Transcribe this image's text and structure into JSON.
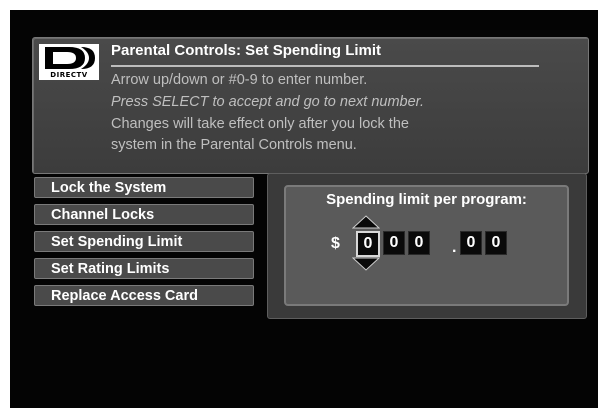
{
  "header": {
    "logo_text": "DIRECTV",
    "title": "Parental Controls: Set Spending Limit",
    "instructions": [
      "Arrow up/down or #0-9 to enter number.",
      "Press SELECT to accept and go to next number.",
      "Changes will take effect only after you lock the",
      "system in the Parental Controls menu."
    ]
  },
  "menu": {
    "items": [
      {
        "label": "Lock the System"
      },
      {
        "label": "Channel Locks"
      },
      {
        "label": "Set Spending Limit"
      },
      {
        "label": "Set Rating Limits"
      },
      {
        "label": "Replace Access Card"
      }
    ]
  },
  "spending": {
    "label": "Spending limit per program:",
    "currency": "$",
    "digits": [
      "0",
      "0",
      "0",
      "0",
      "0"
    ],
    "decimal": ".",
    "selected_index": 0
  },
  "colors": {
    "background": "#040404",
    "panel": "#4a4a4a",
    "text": "#ffffff",
    "instruction_text": "#bfbfbf"
  },
  "icons": [
    "directv-logo-icon",
    "arrow-up-icon",
    "arrow-down-icon"
  ]
}
